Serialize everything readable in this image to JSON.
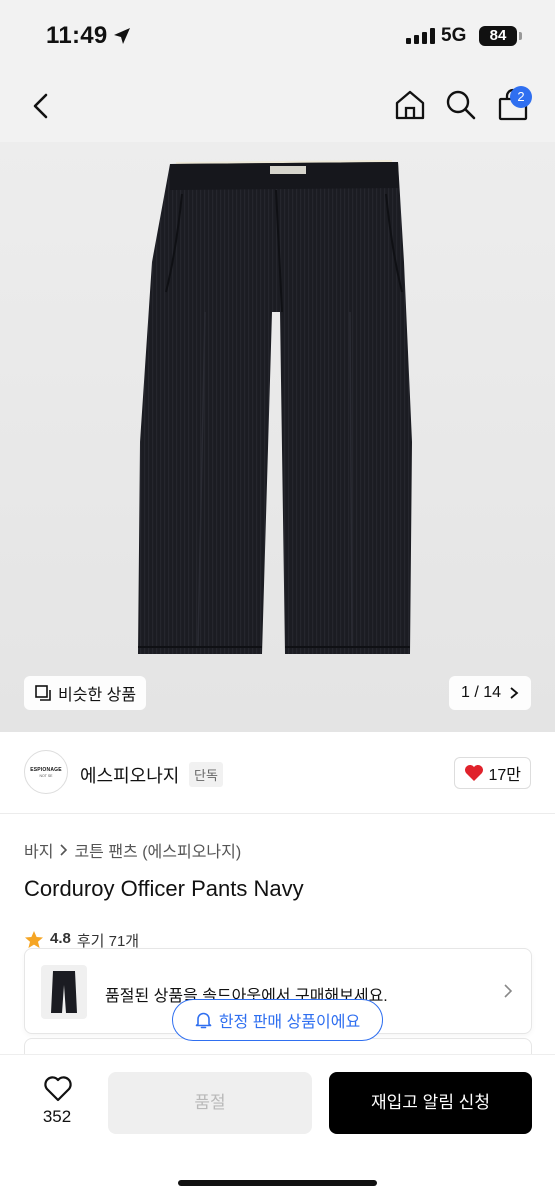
{
  "status": {
    "time": "11:49",
    "network": "5G",
    "battery": "84"
  },
  "nav": {
    "cart_badge": "2"
  },
  "gallery": {
    "similar_label": "비슷한 상품",
    "counter": "1 / 14"
  },
  "brand": {
    "name": "에스피오나지",
    "tag": "단독",
    "logo_line1": "ESPIONAGE",
    "logo_line2": "NOT SE",
    "likes": "17만"
  },
  "breadcrumb": {
    "category": "바지",
    "subcategory": "코튼 팬츠 (에스피오나지)"
  },
  "product": {
    "title": "Corduroy Officer Pants Navy",
    "rating": "4.8",
    "reviews": "후기 71개"
  },
  "soldout_notice": {
    "text": "품절된 상품을 솔드아웃에서 구매해보세요."
  },
  "limited_notice": {
    "text": "한정 판매 상품이에요"
  },
  "bottom_bar": {
    "wish_count": "352",
    "soldout_label": "품절",
    "restock_label": "재입고 알림 신청"
  },
  "colors": {
    "accent": "#2f6ff0",
    "like": "#e0222b",
    "star": "#f5a524"
  }
}
